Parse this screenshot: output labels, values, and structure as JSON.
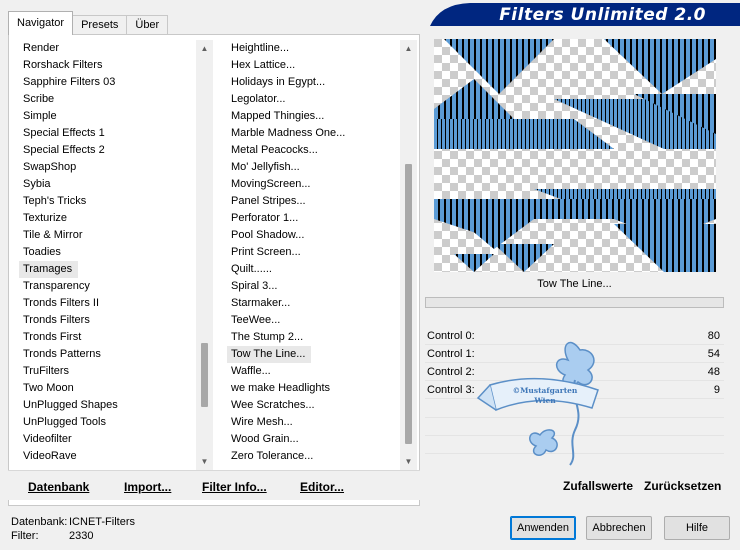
{
  "tabs": [
    {
      "label": "Navigator"
    },
    {
      "label": "Presets"
    },
    {
      "label": "Über"
    }
  ],
  "banner": {
    "title": "Filters Unlimited 2.0"
  },
  "categories": {
    "items": [
      "Render",
      "Rorshack Filters",
      "Sapphire Filters 03",
      "Scribe",
      "Simple",
      "Special Effects 1",
      "Special Effects 2",
      "SwapShop",
      "Sybia",
      "Teph's Tricks",
      "Texturize",
      "Tile & Mirror",
      "Toadies",
      "Tramages",
      "Transparency",
      "Tronds Filters II",
      "Tronds Filters",
      "Tronds First",
      "Tronds Patterns",
      "TruFilters",
      "Two Moon",
      "UnPlugged Shapes",
      "UnPlugged Tools",
      "Videofilter",
      "VideoRave"
    ],
    "selected": "Tramages",
    "scroll_position": 0.86
  },
  "filters": {
    "items": [
      "Heightline...",
      "Hex Lattice...",
      "Holidays in Egypt...",
      "Legolator...",
      "Mapped Thingies...",
      "Marble Madness One...",
      "Metal Peacocks...",
      "Mo' Jellyfish...",
      "MovingScreen...",
      "Panel Stripes...",
      "Perforator 1...",
      "Pool Shadow...",
      "Print Screen...",
      "Quilt......",
      "Spiral 3...",
      "Starmaker...",
      "TeeWee...",
      "The Stump 2...",
      "Tow The Line...",
      "Waffle...",
      "we make Headlights",
      "Wee Scratches...",
      "Wire Mesh...",
      "Wood Grain...",
      "Zero Tolerance..."
    ],
    "selected": "Tow The Line...",
    "scroll_position": 0.92
  },
  "bottom_left_buttons": {
    "database": "Datenbank",
    "import": "Import...",
    "filter_info": "Filter Info...",
    "editor": "Editor..."
  },
  "current_filter": "Tow The Line...",
  "controls": [
    {
      "label": "Control 0:",
      "value": "80"
    },
    {
      "label": "Control 1:",
      "value": "54"
    },
    {
      "label": "Control 2:",
      "value": "48"
    },
    {
      "label": "Control 3:",
      "value": "9"
    }
  ],
  "right_buttons": {
    "random": "Zufallswerte",
    "reset": "Zurücksetzen"
  },
  "status": {
    "database_label": "Datenbank:",
    "database_value": "ICNET-Filters",
    "filter_label": "Filter:",
    "filter_value": "2330"
  },
  "dialog_buttons": {
    "apply": "Anwenden",
    "cancel": "Abbrechen",
    "help": "Hilfe"
  },
  "watermark_text": "©Mustafgarten Wien",
  "colors": {
    "banner_bg": "#002680",
    "preview_blue": "#5b9bd5",
    "stripe": "#000000",
    "checker_dark": "#cccccc",
    "checker_light": "#ffffff",
    "default_button_border": "#0078d7",
    "watermark": "#7fb0e0"
  }
}
